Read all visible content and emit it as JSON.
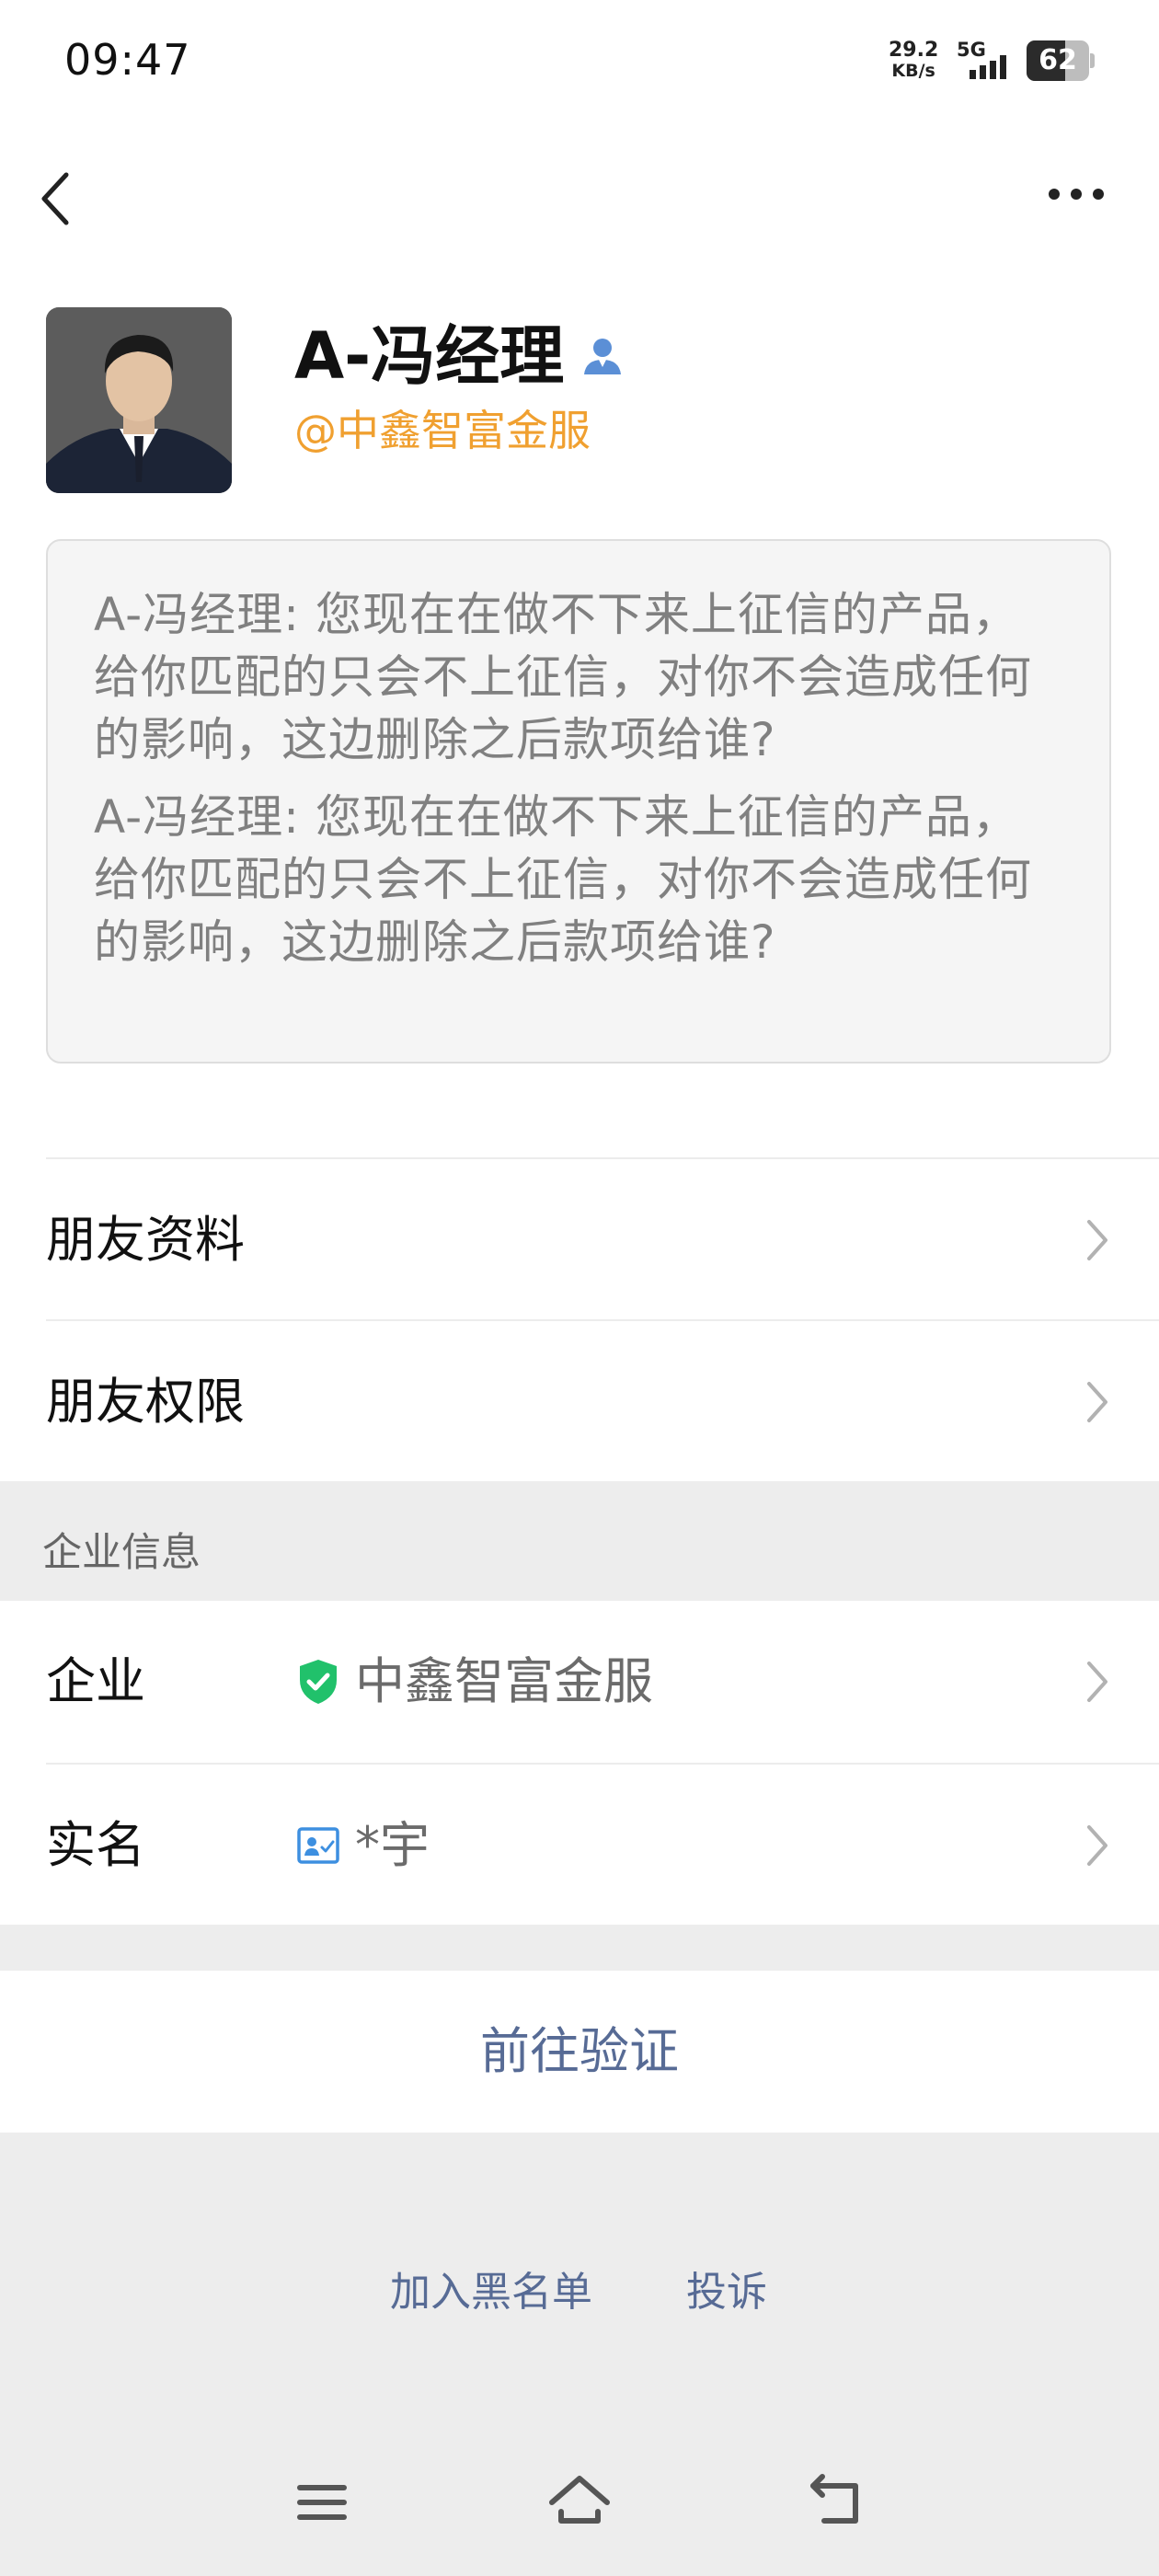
{
  "status_bar": {
    "time": "09:47",
    "network_speed": "29.2",
    "network_speed_unit": "KB/s",
    "network_type": "5G",
    "battery_level": "62",
    "battery_fraction": 0.62
  },
  "header": {
    "back_icon": "chevron-left-icon",
    "more_icon": "more-horizontal-icon"
  },
  "profile": {
    "name": "A-冯经理",
    "company_handle": "@中鑫智富金服",
    "name_badge_icon": "contact-person-icon",
    "accent_color": "#f0a030"
  },
  "message": {
    "paragraphs": [
      "A-冯经理: 您现在在做不下来上征信的产品，给你匹配的只会不上征信，对你不会造成任何的影响，这边删除之后款项给谁?",
      "A-冯经理: 您现在在做不下来上征信的产品，给你匹配的只会不上征信，对你不会造成任何的影响，这边删除之后款项给谁?"
    ]
  },
  "menu": {
    "items": [
      {
        "label": "朋友资料"
      },
      {
        "label": "朋友权限"
      }
    ]
  },
  "enterprise": {
    "section_title": "企业信息",
    "rows": [
      {
        "key": "企业",
        "value": "中鑫智富金服",
        "icon": "shield-check-icon"
      },
      {
        "key": "实名",
        "value": "*宇",
        "icon": "id-card-icon"
      }
    ],
    "verify_label": "前往验证",
    "link_color": "#576b95"
  },
  "footer": {
    "blacklist_label": "加入黑名单",
    "report_label": "投诉"
  },
  "nav": {
    "menu_icon": "menu-icon",
    "home_icon": "home-icon",
    "back_icon": "back-arrow-icon"
  }
}
